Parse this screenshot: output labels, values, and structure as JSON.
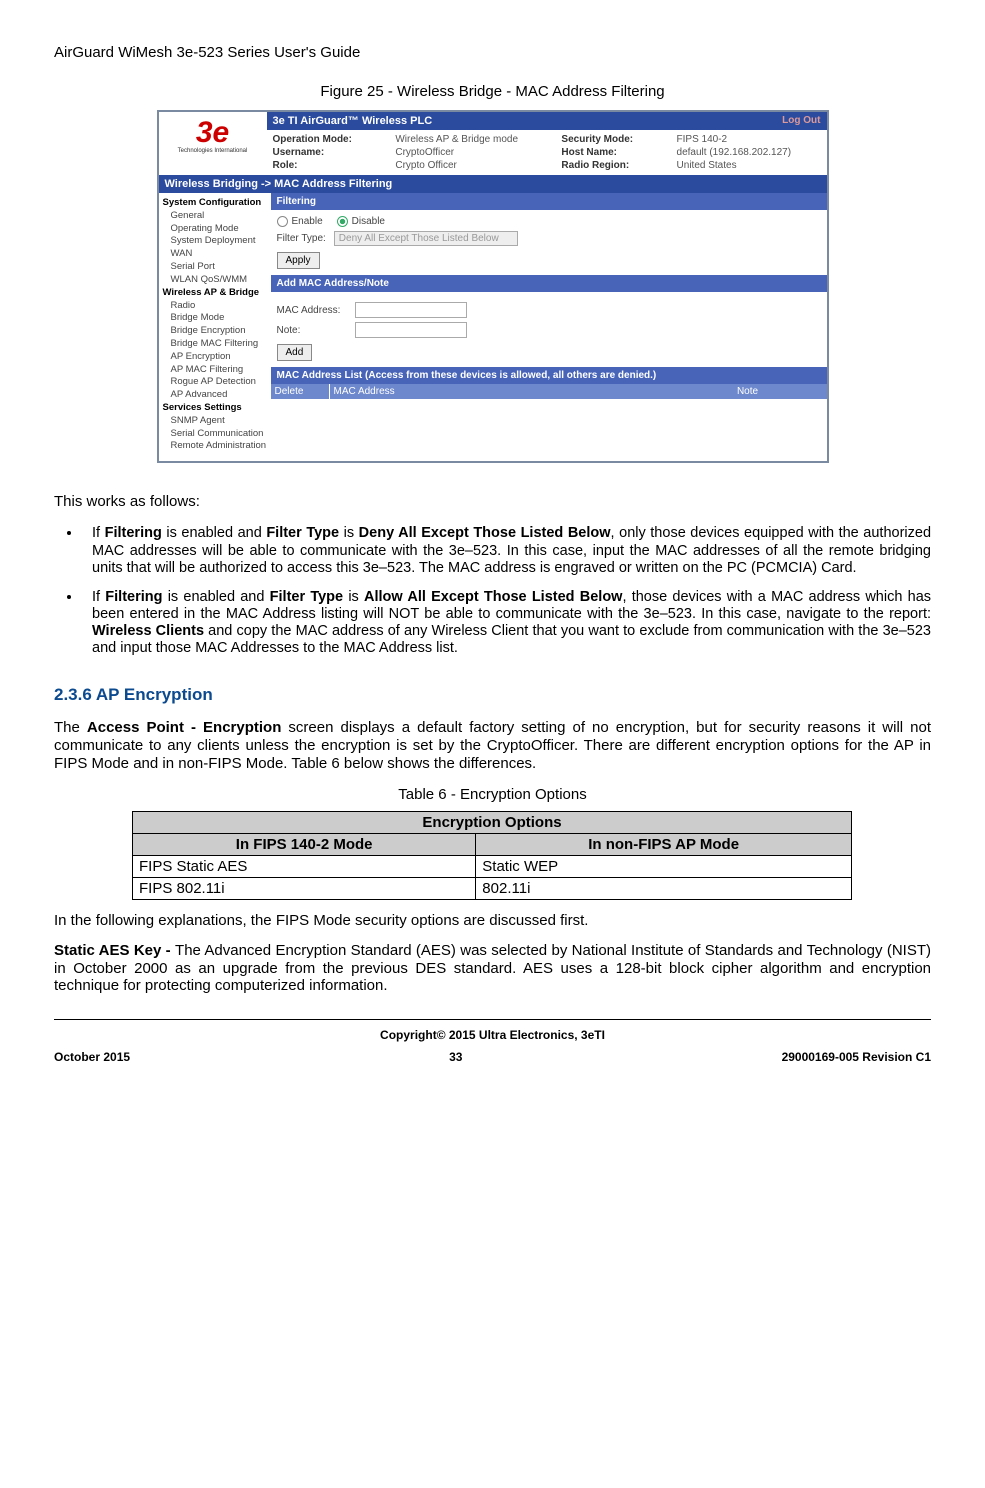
{
  "doc": {
    "header": "AirGuard WiMesh 3e-523 Series User's Guide",
    "figure_caption": "Figure 25 - Wireless Bridge - MAC Address Filtering"
  },
  "screenshot": {
    "product": "3e TI AirGuard™ Wireless PLC",
    "logout": "Log Out",
    "logo_main": "3e",
    "logo_sub": "Technologies International",
    "info": {
      "op_mode_lbl": "Operation Mode:",
      "op_mode_val": "Wireless AP & Bridge mode",
      "sec_mode_lbl": "Security Mode:",
      "sec_mode_val": "FIPS 140-2",
      "user_lbl": "Username:",
      "user_val": "CryptoOfficer",
      "host_lbl": "Host Name:",
      "host_val": "default (192.168.202.127)",
      "role_lbl": "Role:",
      "role_val": "Crypto Officer",
      "region_lbl": "Radio Region:",
      "region_val": "United States"
    },
    "breadcrumb": "Wireless Bridging -> MAC Address Filtering",
    "sidebar": {
      "g1": "System Configuration",
      "g1_items": [
        "General",
        "Operating Mode",
        "System Deployment",
        "WAN",
        "Serial Port",
        "WLAN QoS/WMM"
      ],
      "g2": "Wireless AP & Bridge",
      "g2_items": [
        "Radio",
        "Bridge Mode",
        "Bridge Encryption",
        "Bridge MAC Filtering",
        "AP Encryption",
        "AP MAC Filtering",
        "Rogue AP Detection",
        "AP Advanced"
      ],
      "g3": "Services Settings",
      "g3_items": [
        "SNMP Agent",
        "Serial Communication",
        "Remote Administration"
      ]
    },
    "filtering": {
      "title": "Filtering",
      "enable": "Enable",
      "disable": "Disable",
      "filter_type_lbl": "Filter Type:",
      "filter_type_val": "Deny All Except Those Listed Below",
      "apply": "Apply"
    },
    "add_section": {
      "title": "Add MAC Address/Note",
      "mac_lbl": "MAC Address:",
      "note_lbl": "Note:",
      "add": "Add"
    },
    "list_section": {
      "title": "MAC Address List (Access from these devices is allowed, all others are denied.)",
      "col1": "Delete",
      "col2": "MAC Address",
      "col3": "Note"
    }
  },
  "text": {
    "works": "This works as follows:",
    "bullet1_a": "If ",
    "bullet1_b": "Filtering",
    "bullet1_c": " is enabled and ",
    "bullet1_d": "Filter Type",
    "bullet1_e": " is ",
    "bullet1_f": "Deny All Except Those Listed Below",
    "bullet1_g": ", only those devices equipped with the authorized MAC addresses will be able to communicate with the 3e–523. In this case, input the MAC addresses of all the remote bridging units that will be authorized to access this 3e–523. The MAC address is engraved or written on the PC (PCMCIA) Card.",
    "bullet2_a": "If ",
    "bullet2_b": "Filtering",
    "bullet2_c": " is enabled and ",
    "bullet2_d": "Filter Type",
    "bullet2_e": " is ",
    "bullet2_f": "Allow All Except Those Listed Below",
    "bullet2_g": ", those devices with a MAC address which has been entered in the MAC Address listing will NOT be able to communicate with the 3e–523. In this case, navigate to the report: ",
    "bullet2_h": "Wireless Clients",
    "bullet2_i": " and copy the MAC address of any Wireless Client that you want to exclude from communication with the 3e–523 and input those MAC Addresses to the MAC Address list.",
    "heading": "2.3.6   AP Encryption",
    "para2_a": "The ",
    "para2_b": "Access Point - Encryption",
    "para2_c": " screen displays a default factory setting of no encryption, but for security reasons it will not communicate to any clients unless the encryption is set by the CryptoOfficer. There are different encryption options for the AP in FIPS Mode and in non-FIPS Mode. Table 6 below shows the differences.",
    "table_caption": "Table 6 - Encryption Options",
    "para3": "In the following explanations, the FIPS Mode security options are discussed first.",
    "para4_a": "Static AES Key - ",
    "para4_b": "The Advanced Encryption Standard (AES) was selected by National Institute of Standards and Technology (NIST) in October 2000 as an upgrade from the previous DES standard.   AES uses a 128-bit block cipher algorithm and encryption technique for protecting computerized information."
  },
  "table": {
    "title": "Encryption Options",
    "h1": "In FIPS 140-2 Mode",
    "h2": "In non-FIPS AP Mode",
    "r1c1": "FIPS Static AES",
    "r1c2": "Static WEP",
    "r2c1": "FIPS 802.11i",
    "r2c2": "802.11i"
  },
  "footer": {
    "copyright": "Copyright© 2015 Ultra Electronics, 3eTI",
    "left": "October 2015",
    "center": "33",
    "right": "29000169-005 Revision C1"
  }
}
